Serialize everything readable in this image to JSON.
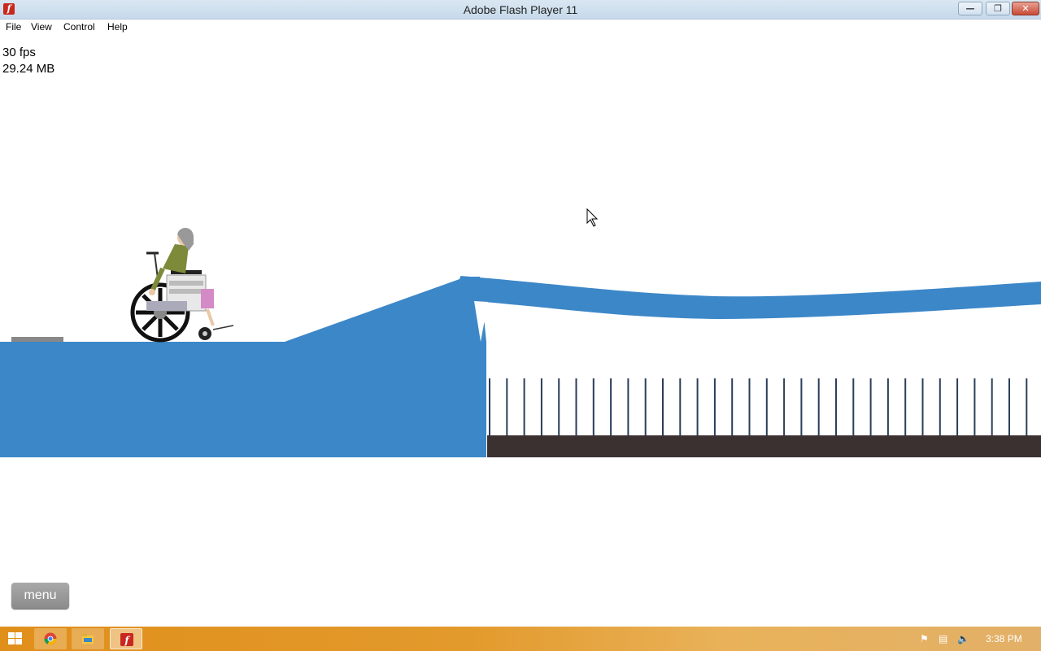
{
  "window": {
    "title": "Adobe Flash Player 11"
  },
  "menubar": {
    "items": [
      "File",
      "View",
      "Control",
      "Help"
    ]
  },
  "game": {
    "fps": "30 fps",
    "memory": "29.24 MB",
    "menu_button": "menu",
    "colors": {
      "ground": "#3c87c8",
      "spike_base": "#3b3131",
      "spikes": "#2b3e5a"
    }
  },
  "taskbar": {
    "apps": [
      "chrome-icon",
      "file-explorer-icon",
      "flash-player-icon"
    ],
    "clock": "3:38 PM"
  }
}
